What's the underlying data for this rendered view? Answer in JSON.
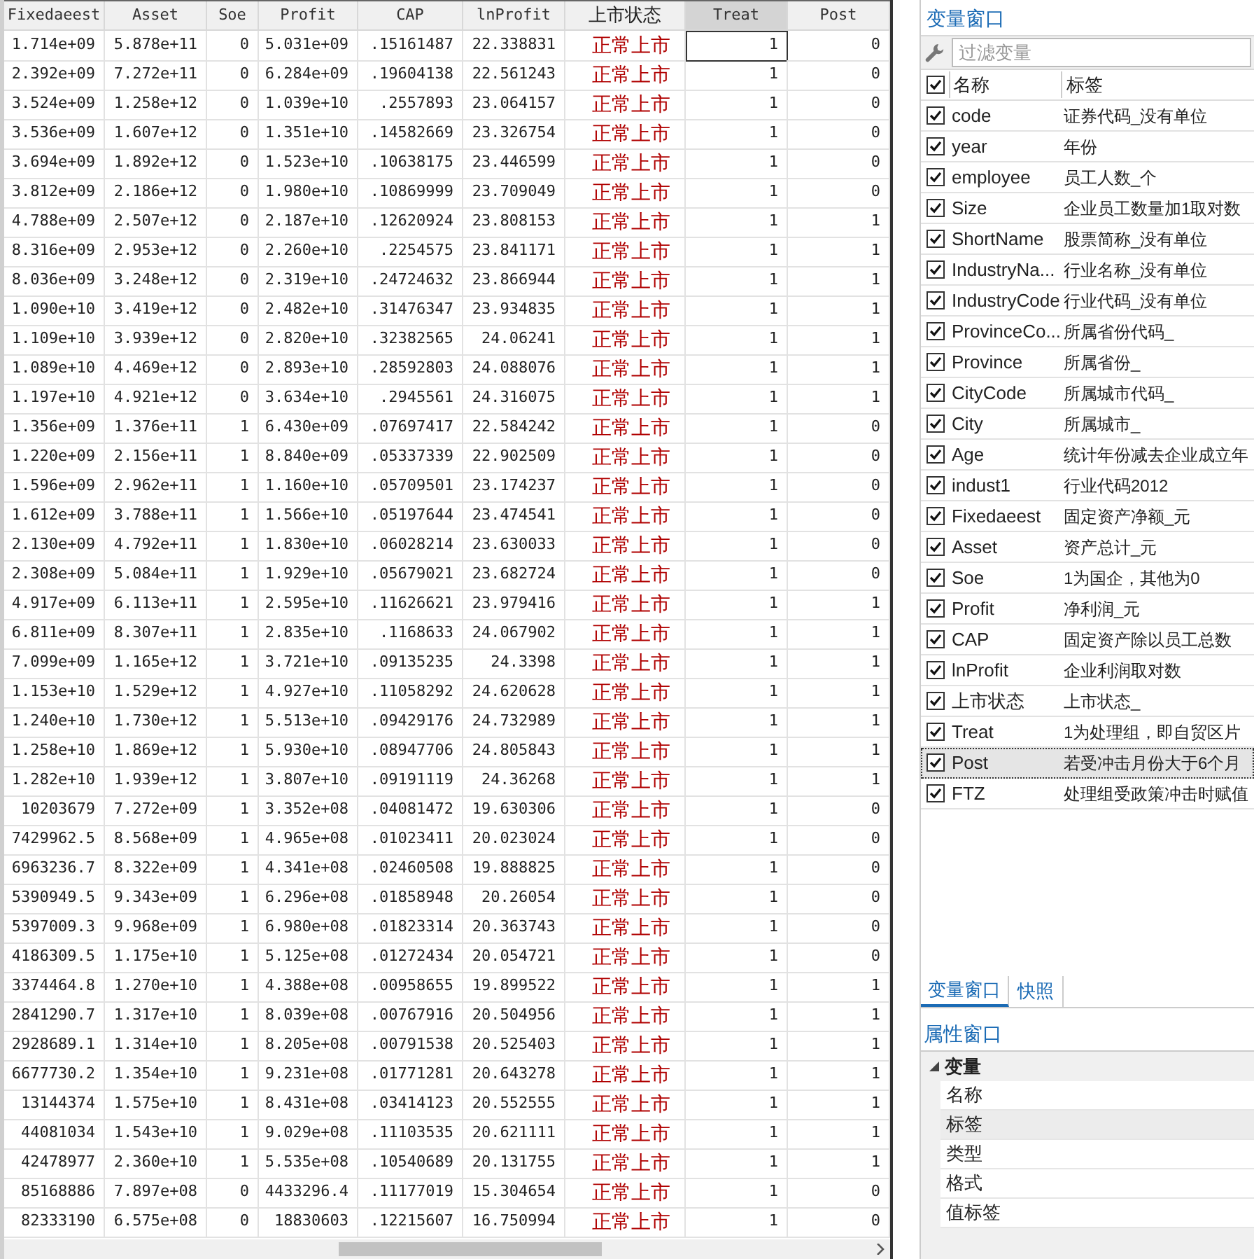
{
  "table": {
    "columns": [
      {
        "label": "Fixedaeest",
        "kind": "numeric",
        "selected": false
      },
      {
        "label": "Asset",
        "kind": "numeric",
        "selected": false
      },
      {
        "label": "Soe",
        "kind": "numeric",
        "selected": false
      },
      {
        "label": "Profit",
        "kind": "numeric",
        "selected": false
      },
      {
        "label": "CAP",
        "kind": "numeric",
        "selected": false
      },
      {
        "label": "lnProfit",
        "kind": "numeric",
        "selected": false
      },
      {
        "label": "上市状态",
        "kind": "string",
        "selected": false
      },
      {
        "label": "Treat",
        "kind": "numeric",
        "selected": true
      },
      {
        "label": "Post",
        "kind": "numeric",
        "selected": false
      }
    ],
    "rows": [
      {
        "selected": true,
        "cells": [
          "1.714e+09",
          "5.878e+11",
          "0",
          "5.031e+09",
          ".15161487",
          "22.338831",
          "正常上市",
          "1",
          "0"
        ]
      },
      {
        "selected": false,
        "cells": [
          "2.392e+09",
          "7.272e+11",
          "0",
          "6.284e+09",
          ".19604138",
          "22.561243",
          "正常上市",
          "1",
          "0"
        ]
      },
      {
        "selected": false,
        "cells": [
          "3.524e+09",
          "1.258e+12",
          "0",
          "1.039e+10",
          ".2557893",
          "23.064157",
          "正常上市",
          "1",
          "0"
        ]
      },
      {
        "selected": false,
        "cells": [
          "3.536e+09",
          "1.607e+12",
          "0",
          "1.351e+10",
          ".14582669",
          "23.326754",
          "正常上市",
          "1",
          "0"
        ]
      },
      {
        "selected": false,
        "cells": [
          "3.694e+09",
          "1.892e+12",
          "0",
          "1.523e+10",
          ".10638175",
          "23.446599",
          "正常上市",
          "1",
          "0"
        ]
      },
      {
        "selected": false,
        "cells": [
          "3.812e+09",
          "2.186e+12",
          "0",
          "1.980e+10",
          ".10869999",
          "23.709049",
          "正常上市",
          "1",
          "0"
        ]
      },
      {
        "selected": false,
        "cells": [
          "4.788e+09",
          "2.507e+12",
          "0",
          "2.187e+10",
          ".12620924",
          "23.808153",
          "正常上市",
          "1",
          "1"
        ]
      },
      {
        "selected": false,
        "cells": [
          "8.316e+09",
          "2.953e+12",
          "0",
          "2.260e+10",
          ".2254575",
          "23.841171",
          "正常上市",
          "1",
          "1"
        ]
      },
      {
        "selected": false,
        "cells": [
          "8.036e+09",
          "3.248e+12",
          "0",
          "2.319e+10",
          ".24724632",
          "23.866944",
          "正常上市",
          "1",
          "1"
        ]
      },
      {
        "selected": false,
        "cells": [
          "1.090e+10",
          "3.419e+12",
          "0",
          "2.482e+10",
          ".31476347",
          "23.934835",
          "正常上市",
          "1",
          "1"
        ]
      },
      {
        "selected": false,
        "cells": [
          "1.109e+10",
          "3.939e+12",
          "0",
          "2.820e+10",
          ".32382565",
          "24.06241",
          "正常上市",
          "1",
          "1"
        ]
      },
      {
        "selected": false,
        "cells": [
          "1.089e+10",
          "4.469e+12",
          "0",
          "2.893e+10",
          ".28592803",
          "24.088076",
          "正常上市",
          "1",
          "1"
        ]
      },
      {
        "selected": false,
        "cells": [
          "1.197e+10",
          "4.921e+12",
          "0",
          "3.634e+10",
          ".2945561",
          "24.316075",
          "正常上市",
          "1",
          "1"
        ]
      },
      {
        "selected": false,
        "cells": [
          "1.356e+09",
          "1.376e+11",
          "1",
          "6.430e+09",
          ".07697417",
          "22.584242",
          "正常上市",
          "1",
          "0"
        ]
      },
      {
        "selected": false,
        "cells": [
          "1.220e+09",
          "2.156e+11",
          "1",
          "8.840e+09",
          ".05337339",
          "22.902509",
          "正常上市",
          "1",
          "0"
        ]
      },
      {
        "selected": false,
        "cells": [
          "1.596e+09",
          "2.962e+11",
          "1",
          "1.160e+10",
          ".05709501",
          "23.174237",
          "正常上市",
          "1",
          "0"
        ]
      },
      {
        "selected": false,
        "cells": [
          "1.612e+09",
          "3.788e+11",
          "1",
          "1.566e+10",
          ".05197644",
          "23.474541",
          "正常上市",
          "1",
          "0"
        ]
      },
      {
        "selected": false,
        "cells": [
          "2.130e+09",
          "4.792e+11",
          "1",
          "1.830e+10",
          ".06028214",
          "23.630033",
          "正常上市",
          "1",
          "0"
        ]
      },
      {
        "selected": false,
        "cells": [
          "2.308e+09",
          "5.084e+11",
          "1",
          "1.929e+10",
          ".05679021",
          "23.682724",
          "正常上市",
          "1",
          "0"
        ]
      },
      {
        "selected": false,
        "cells": [
          "4.917e+09",
          "6.113e+11",
          "1",
          "2.595e+10",
          ".11626621",
          "23.979416",
          "正常上市",
          "1",
          "1"
        ]
      },
      {
        "selected": false,
        "cells": [
          "6.811e+09",
          "8.307e+11",
          "1",
          "2.835e+10",
          ".1168633",
          "24.067902",
          "正常上市",
          "1",
          "1"
        ]
      },
      {
        "selected": false,
        "cells": [
          "7.099e+09",
          "1.165e+12",
          "1",
          "3.721e+10",
          ".09135235",
          "24.3398",
          "正常上市",
          "1",
          "1"
        ]
      },
      {
        "selected": false,
        "cells": [
          "1.153e+10",
          "1.529e+12",
          "1",
          "4.927e+10",
          ".11058292",
          "24.620628",
          "正常上市",
          "1",
          "1"
        ]
      },
      {
        "selected": false,
        "cells": [
          "1.240e+10",
          "1.730e+12",
          "1",
          "5.513e+10",
          ".09429176",
          "24.732989",
          "正常上市",
          "1",
          "1"
        ]
      },
      {
        "selected": false,
        "cells": [
          "1.258e+10",
          "1.869e+12",
          "1",
          "5.930e+10",
          ".08947706",
          "24.805843",
          "正常上市",
          "1",
          "1"
        ]
      },
      {
        "selected": false,
        "cells": [
          "1.282e+10",
          "1.939e+12",
          "1",
          "3.807e+10",
          ".09191119",
          "24.36268",
          "正常上市",
          "1",
          "1"
        ]
      },
      {
        "selected": false,
        "cells": [
          "10203679",
          "7.272e+09",
          "1",
          "3.352e+08",
          ".04081472",
          "19.630306",
          "正常上市",
          "1",
          "0"
        ]
      },
      {
        "selected": false,
        "cells": [
          "7429962.5",
          "8.568e+09",
          "1",
          "4.965e+08",
          ".01023411",
          "20.023024",
          "正常上市",
          "1",
          "0"
        ]
      },
      {
        "selected": false,
        "cells": [
          "6963236.7",
          "8.322e+09",
          "1",
          "4.341e+08",
          ".02460508",
          "19.888825",
          "正常上市",
          "1",
          "0"
        ]
      },
      {
        "selected": false,
        "cells": [
          "5390949.5",
          "9.343e+09",
          "1",
          "6.296e+08",
          ".01858948",
          "20.26054",
          "正常上市",
          "1",
          "0"
        ]
      },
      {
        "selected": false,
        "cells": [
          "5397009.3",
          "9.968e+09",
          "1",
          "6.980e+08",
          ".01823314",
          "20.363743",
          "正常上市",
          "1",
          "0"
        ]
      },
      {
        "selected": false,
        "cells": [
          "4186309.5",
          "1.175e+10",
          "1",
          "5.125e+08",
          ".01272434",
          "20.054721",
          "正常上市",
          "1",
          "0"
        ]
      },
      {
        "selected": false,
        "cells": [
          "3374464.8",
          "1.270e+10",
          "1",
          "4.388e+08",
          ".00958655",
          "19.899522",
          "正常上市",
          "1",
          "1"
        ]
      },
      {
        "selected": false,
        "cells": [
          "2841290.7",
          "1.317e+10",
          "1",
          "8.039e+08",
          ".00767916",
          "20.504956",
          "正常上市",
          "1",
          "1"
        ]
      },
      {
        "selected": false,
        "cells": [
          "2928689.1",
          "1.314e+10",
          "1",
          "8.205e+08",
          ".00791538",
          "20.525403",
          "正常上市",
          "1",
          "1"
        ]
      },
      {
        "selected": false,
        "cells": [
          "6677730.2",
          "1.354e+10",
          "1",
          "9.231e+08",
          ".01771281",
          "20.643278",
          "正常上市",
          "1",
          "1"
        ]
      },
      {
        "selected": false,
        "cells": [
          "13144374",
          "1.575e+10",
          "1",
          "8.431e+08",
          ".03414123",
          "20.552555",
          "正常上市",
          "1",
          "1"
        ]
      },
      {
        "selected": false,
        "cells": [
          "44081034",
          "1.543e+10",
          "1",
          "9.029e+08",
          ".11103535",
          "20.621111",
          "正常上市",
          "1",
          "1"
        ]
      },
      {
        "selected": false,
        "cells": [
          "42478977",
          "2.360e+10",
          "1",
          "5.535e+08",
          ".10540689",
          "20.131755",
          "正常上市",
          "1",
          "1"
        ]
      },
      {
        "selected": false,
        "cells": [
          "85168886",
          "7.897e+08",
          "0",
          "4433296.4",
          ".11177019",
          "15.304654",
          "正常上市",
          "1",
          "0"
        ]
      },
      {
        "selected": false,
        "cells": [
          "82333190",
          "6.575e+08",
          "0",
          "18830603",
          ".12215607",
          "16.750994",
          "正常上市",
          "1",
          "0"
        ]
      }
    ]
  },
  "variables_window": {
    "title": "变量窗口",
    "filter": {
      "placeholder": "过滤变量"
    },
    "header": {
      "all_checked": true,
      "name": "名称",
      "label": "标签"
    },
    "variables": [
      {
        "name": "code",
        "label": "证券代码_没有单位",
        "checked": true,
        "selected": false
      },
      {
        "name": "year",
        "label": "年份",
        "checked": true,
        "selected": false
      },
      {
        "name": "employee",
        "label": "员工人数_个",
        "checked": true,
        "selected": false
      },
      {
        "name": "Size",
        "label": "企业员工数量加1取对数",
        "checked": true,
        "selected": false
      },
      {
        "name": "ShortName",
        "label": "股票简称_没有单位",
        "checked": true,
        "selected": false
      },
      {
        "name": "IndustryNa...",
        "label": "行业名称_没有单位",
        "checked": true,
        "selected": false
      },
      {
        "name": "IndustryCode",
        "label": "行业代码_没有单位",
        "checked": true,
        "selected": false
      },
      {
        "name": "ProvinceCo...",
        "label": "所属省份代码_",
        "checked": true,
        "selected": false
      },
      {
        "name": "Province",
        "label": "所属省份_",
        "checked": true,
        "selected": false
      },
      {
        "name": "CityCode",
        "label": "所属城市代码_",
        "checked": true,
        "selected": false
      },
      {
        "name": "City",
        "label": "所属城市_",
        "checked": true,
        "selected": false
      },
      {
        "name": "Age",
        "label": "统计年份减去企业成立年",
        "checked": true,
        "selected": false
      },
      {
        "name": "indust1",
        "label": "行业代码2012",
        "checked": true,
        "selected": false
      },
      {
        "name": "Fixedaeest",
        "label": "固定资产净额_元",
        "checked": true,
        "selected": false
      },
      {
        "name": "Asset",
        "label": "资产总计_元",
        "checked": true,
        "selected": false
      },
      {
        "name": "Soe",
        "label": "1为国企，其他为0",
        "checked": true,
        "selected": false
      },
      {
        "name": "Profit",
        "label": "净利润_元",
        "checked": true,
        "selected": false
      },
      {
        "name": "CAP",
        "label": "固定资产除以员工总数",
        "checked": true,
        "selected": false
      },
      {
        "name": "lnProfit",
        "label": "企业利润取对数",
        "checked": true,
        "selected": false
      },
      {
        "name": "上市状态",
        "label": "上市状态_",
        "checked": true,
        "selected": false
      },
      {
        "name": "Treat",
        "label": "1为处理组，即自贸区片",
        "checked": true,
        "selected": false
      },
      {
        "name": "Post",
        "label": "若受冲击月份大于6个月",
        "checked": true,
        "selected": true
      },
      {
        "name": "FTZ",
        "label": "处理组受政策冲击时赋值",
        "checked": true,
        "selected": false
      }
    ]
  },
  "tabs": [
    {
      "label": "变量窗口",
      "selected": true
    },
    {
      "label": "快照",
      "selected": false
    }
  ],
  "properties_window": {
    "title": "属性窗口",
    "group": {
      "label": "变量",
      "expanded": true,
      "items": [
        {
          "label": "名称",
          "selected": false
        },
        {
          "label": "标签",
          "selected": true
        },
        {
          "label": "类型",
          "selected": false
        },
        {
          "label": "格式",
          "selected": false
        },
        {
          "label": "值标签",
          "selected": false
        }
      ]
    }
  }
}
